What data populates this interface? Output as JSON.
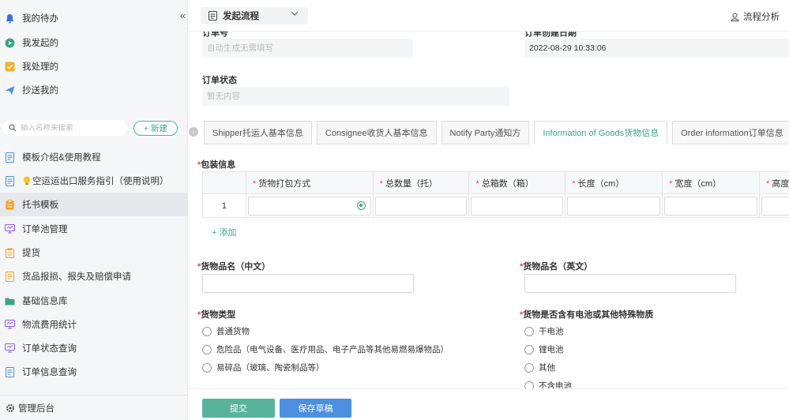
{
  "sidebar": {
    "top_items": [
      {
        "label": "我的待办",
        "icon": "bell-icon",
        "color": "#3a6fe0"
      },
      {
        "label": "我发起的",
        "icon": "play-circle-icon",
        "color": "#3aa585"
      },
      {
        "label": "我处理的",
        "icon": "check-square-icon",
        "color": "#f0b429"
      },
      {
        "label": "抄送我的",
        "icon": "send-icon",
        "color": "#4a8fe0"
      }
    ],
    "search_placeholder": "输入名称来搜索",
    "new_button": "+ 新建",
    "items": [
      {
        "label": "模板介绍&使用教程",
        "icon": "document-icon",
        "color": "#4a8fe0"
      },
      {
        "label": "空运运出口服务指引（使用说明）",
        "icon": "document-icon",
        "color": "#4a8fe0"
      },
      {
        "label": "托书模板",
        "icon": "clipboard-icon",
        "color": "#f0a020"
      },
      {
        "label": "订单池管理",
        "icon": "monitor-icon",
        "color": "#8b5cf6"
      },
      {
        "label": "提货",
        "icon": "clipboard-icon",
        "color": "#f0a020"
      },
      {
        "label": "货品报损、报失及赔偿申请",
        "icon": "document-icon",
        "color": "#f0a020"
      },
      {
        "label": "基础信息库",
        "icon": "folder-icon",
        "color": "#3aa585"
      },
      {
        "label": "物流费用统计",
        "icon": "monitor-icon",
        "color": "#8b5cf6"
      },
      {
        "label": "订单状态查询",
        "icon": "monitor-icon",
        "color": "#8b5cf6"
      },
      {
        "label": "订单信息查询",
        "icon": "document-icon",
        "color": "#4a8fe0"
      }
    ],
    "active_index": 2,
    "admin_label": "管理后台"
  },
  "topbar": {
    "flow_label": "发起流程",
    "analysis_label": "流程分析"
  },
  "form": {
    "order_no_label": "订单号",
    "order_no_placeholder": "自动生成无需填写",
    "order_date_label": "订单创建日期",
    "order_date_value": "2022-08-29 10:33:06",
    "order_status_label": "订单状态",
    "order_status_placeholder": "暂无内容",
    "tabs": [
      "Shipper托运人基本信息",
      "Consignee收货人基本信息",
      "Notify Party通知方",
      "Information of Goods货物信息",
      "Order information订单信息"
    ],
    "active_tab": 3,
    "packing_label": "包装信息",
    "table_headers": [
      "货物打包方式",
      "总数量（托）",
      "总箱数（箱）",
      "长度（cm）",
      "宽度（cm）",
      "高度"
    ],
    "row_number": "1",
    "add_label": "+ 添加",
    "name_cn_label": "货物品名（中文）",
    "name_en_label": "货物品名（英文）",
    "goods_type_label": "货物类型",
    "goods_types": [
      "普通货物",
      "危险品（电气设备、医疗用品、电子产品等其他易燃易爆物品）",
      "易碎品（玻璃、陶瓷制品等）"
    ],
    "battery_label": "货物是否含有电池或其他特殊物质",
    "battery_options": [
      "干电池",
      "锂电池",
      "其他",
      "不含电池"
    ]
  },
  "footer": {
    "submit_label": "提交",
    "draft_label": "保存草稿"
  },
  "colors": {
    "accent": "#3aa585",
    "submit": "#58b39b",
    "draft": "#4a8fe0"
  }
}
